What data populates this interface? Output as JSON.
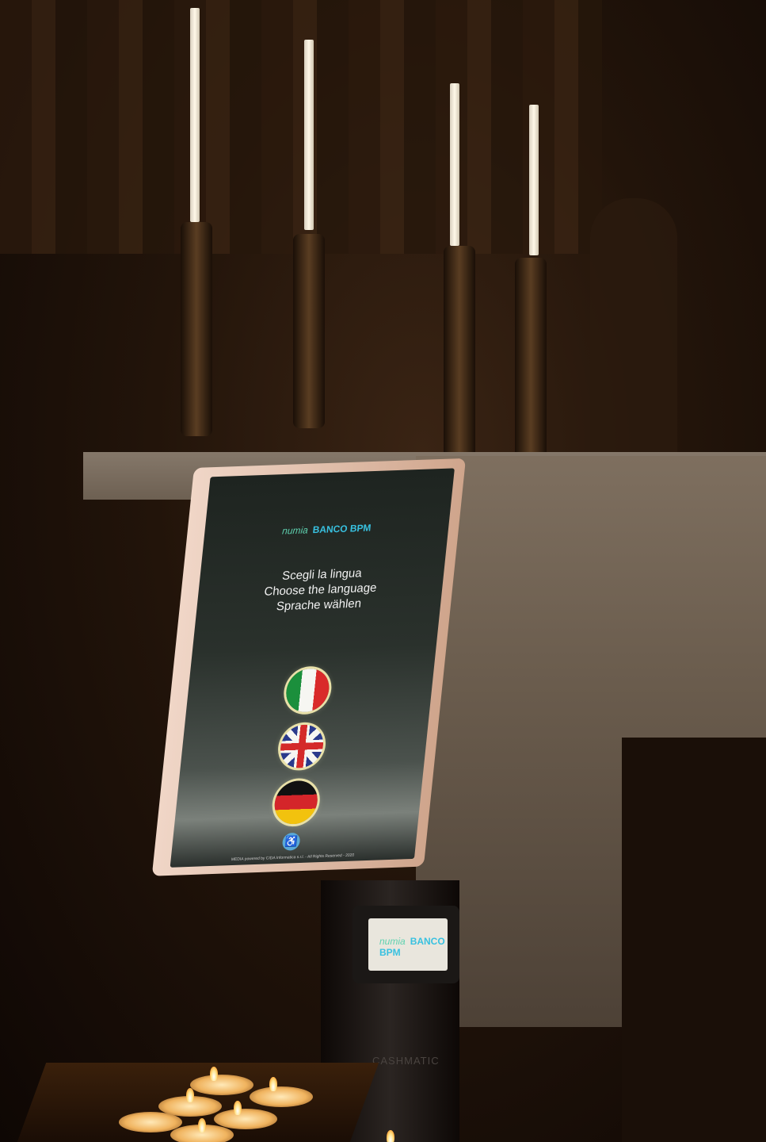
{
  "kiosk": {
    "logo_numia": "numia",
    "logo_banco": "BANCO BPM",
    "language_prompts": [
      "Scegli la lingua",
      "Choose the language",
      "Sprache wählen"
    ],
    "flag_italian_icon": "italy-flag-icon",
    "flag_english_icon": "uk-flag-icon",
    "flag_german_icon": "germany-flag-icon",
    "accessibility_icon": "accessibility-icon",
    "footer": "MEDIA powered by CIDA Informatica s.r.l. - All Rights Reserved - 2020"
  },
  "card_reader": {
    "logo_numia": "numia",
    "logo_banco": "BANCO BPM"
  },
  "stand": {
    "brand": "CASHMATIC"
  }
}
